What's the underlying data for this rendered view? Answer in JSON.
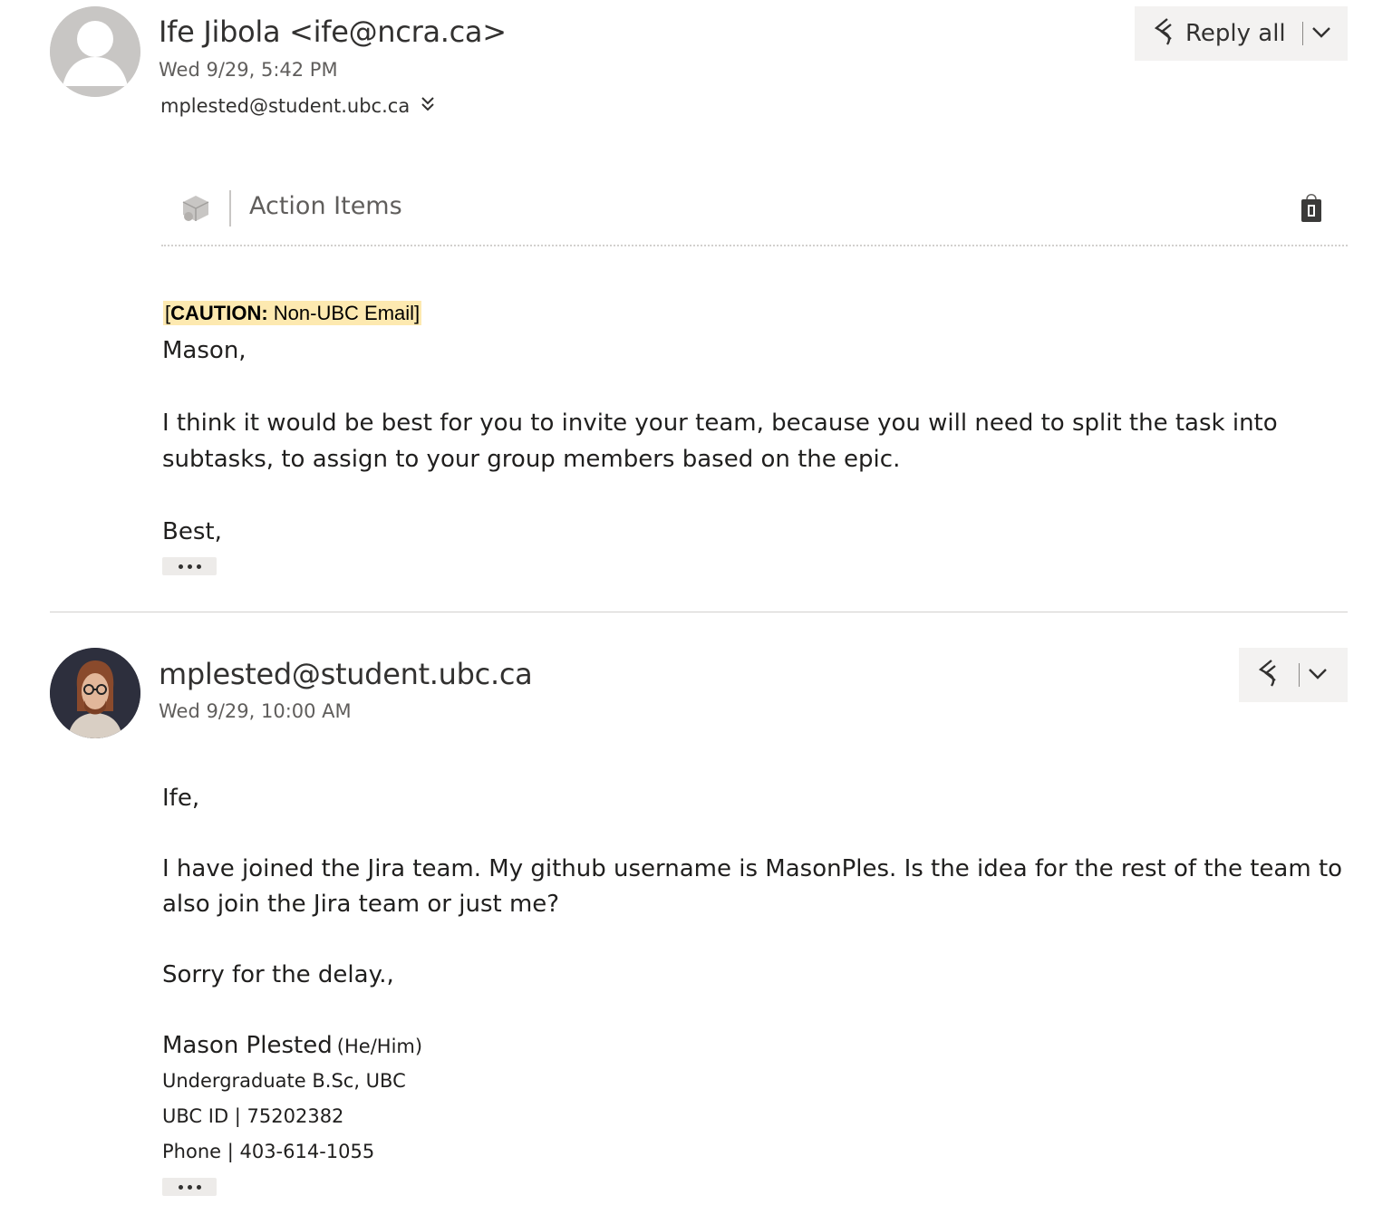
{
  "messages": [
    {
      "sender": "Ife Jibola <ife@ncra.ca>",
      "date": "Wed 9/29, 5:42 PM",
      "to": "mplested@student.ubc.ca",
      "reply_all_label": "Reply all",
      "addin_label": "Action Items",
      "caution_bold": "CAUTION:",
      "caution_text": " Non-UBC Email]",
      "caution_open": "[",
      "body": [
        "Mason,",
        "I think it would be best for you to invite your team, because you will need to split the task into",
        "subtasks, to assign to your group members based on the epic.",
        "Best,"
      ]
    },
    {
      "sender": "mplested@student.ubc.ca",
      "date": "Wed 9/29, 10:00 AM",
      "body": [
        "Ife,",
        "I have joined the Jira team. My github username is MasonPles. Is the idea for the rest of the team to",
        "also join the Jira team or just me?",
        "Sorry for the delay.,"
      ],
      "signature": {
        "name": "Mason Plested",
        "pronouns": "(He/Him)",
        "line1": "Undergraduate B.Sc, UBC",
        "line2": "UBC ID | 75202382",
        "line3": "Phone | 403-614-1055"
      }
    }
  ],
  "icons": {
    "avatar_default": "person-avatar-icon",
    "reply_all": "reply-all-icon",
    "reply": "reply-icon",
    "chevron": "chevron-down-icon",
    "expand": "double-chevron-down-icon",
    "addin": "cube-icon",
    "store": "office-store-icon",
    "more": "ellipsis-icon"
  },
  "colors": {
    "caution_highlight": "#fde9b0",
    "button_bg": "#f3f2f1",
    "secondary_text": "#605e5c"
  }
}
